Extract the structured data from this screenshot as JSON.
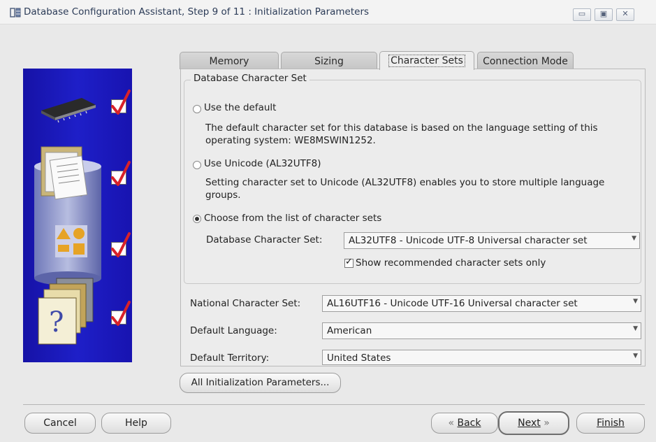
{
  "window": {
    "title": "Database Configuration Assistant, Step 9 of 11 : Initialization Parameters",
    "controls": {
      "minimize_icon": "minimize-icon",
      "maximize_icon": "maximize-icon",
      "close_icon": "close-icon"
    }
  },
  "illustration": {
    "items": [
      {
        "icon": "memory-chip-icon",
        "checked": true
      },
      {
        "icon": "documents-icon",
        "checked": true
      },
      {
        "icon": "shapes-icon",
        "checked": true
      },
      {
        "icon": "help-folder-icon",
        "checked": true
      }
    ]
  },
  "tabs": [
    {
      "label": "Memory",
      "active": false
    },
    {
      "label": "Sizing",
      "active": false
    },
    {
      "label": "Character Sets",
      "active": true
    },
    {
      "label": "Connection Mode",
      "active": false
    }
  ],
  "database_charset": {
    "group_title": "Database Character Set",
    "option_default": {
      "label": "Use the default",
      "description_line1": "The default character set for this database is based on the language setting of this",
      "description_line2": "operating system: WE8MSWIN1252.",
      "selected": false
    },
    "option_unicode": {
      "label": "Use Unicode (AL32UTF8)",
      "description_line1": "Setting character set to Unicode (AL32UTF8) enables you to store multiple language",
      "description_line2": "groups.",
      "selected": false
    },
    "option_list": {
      "label": "Choose from the list of character sets",
      "selected": true,
      "field_label": "Database Character Set:",
      "field_value": "AL32UTF8 - Unicode UTF-8 Universal character set",
      "recommended_label": "Show recommended character sets only",
      "recommended_checked": true
    }
  },
  "national_charset": {
    "label": "National Character Set:",
    "value": "AL16UTF16 - Unicode UTF-16 Universal character set"
  },
  "default_language": {
    "label": "Default Language:",
    "value": "American"
  },
  "default_territory": {
    "label": "Default Territory:",
    "value": "United States"
  },
  "all_params_button": "All Initialization Parameters...",
  "footer": {
    "cancel": "Cancel",
    "help": "Help",
    "back": "Back",
    "next": "Next",
    "finish": "Finish"
  }
}
